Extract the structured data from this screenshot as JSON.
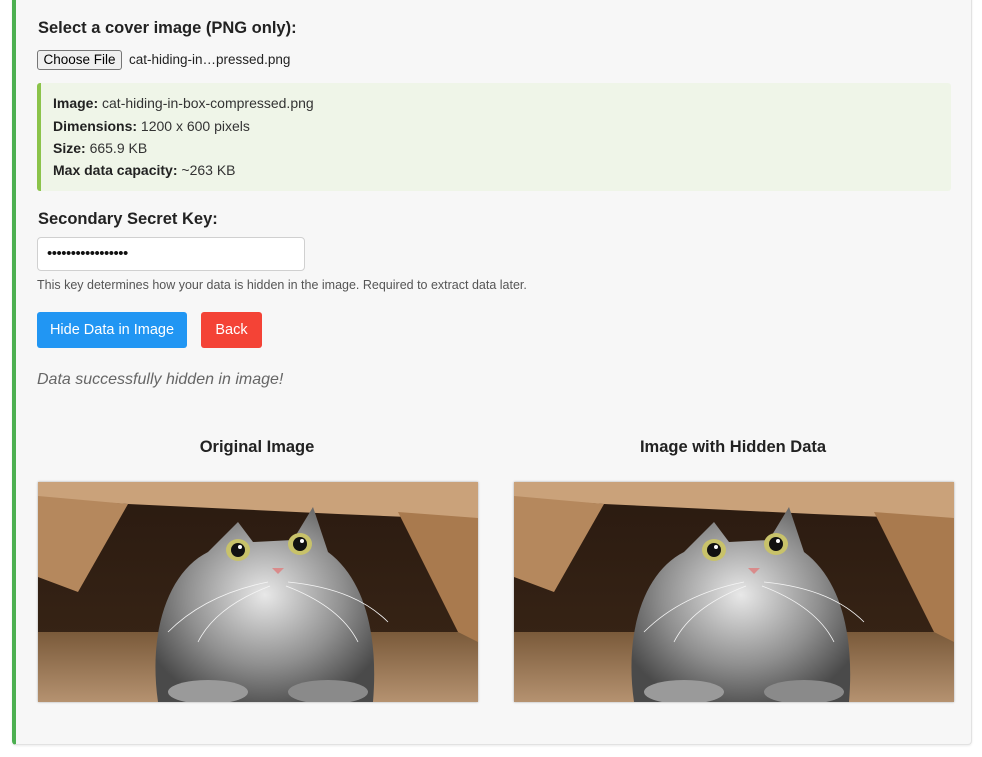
{
  "cover": {
    "heading": "Select a cover image (PNG only):",
    "choose_button": "Choose File",
    "file_name": "cat-hiding-in…pressed.png"
  },
  "info": {
    "image_label": "Image:",
    "image_value": "cat-hiding-in-box-compressed.png",
    "dimensions_label": "Dimensions:",
    "dimensions_value": "1200 x 600 pixels",
    "size_label": "Size:",
    "size_value": "665.9 KB",
    "capacity_label": "Max data capacity:",
    "capacity_value": "~263 KB"
  },
  "key": {
    "heading": "Secondary Secret Key:",
    "value_masked": "•••••••••••••••••",
    "help": "This key determines how your data is hidden in the image. Required to extract data later."
  },
  "actions": {
    "hide_label": "Hide Data in Image",
    "back_label": "Back"
  },
  "status": "Data successfully hidden in image!",
  "images": {
    "original_title": "Original Image",
    "hidden_title": "Image with Hidden Data"
  },
  "colors": {
    "accent_green": "#4caf50",
    "primary_blue": "#2196f3",
    "danger_red": "#f44336"
  }
}
